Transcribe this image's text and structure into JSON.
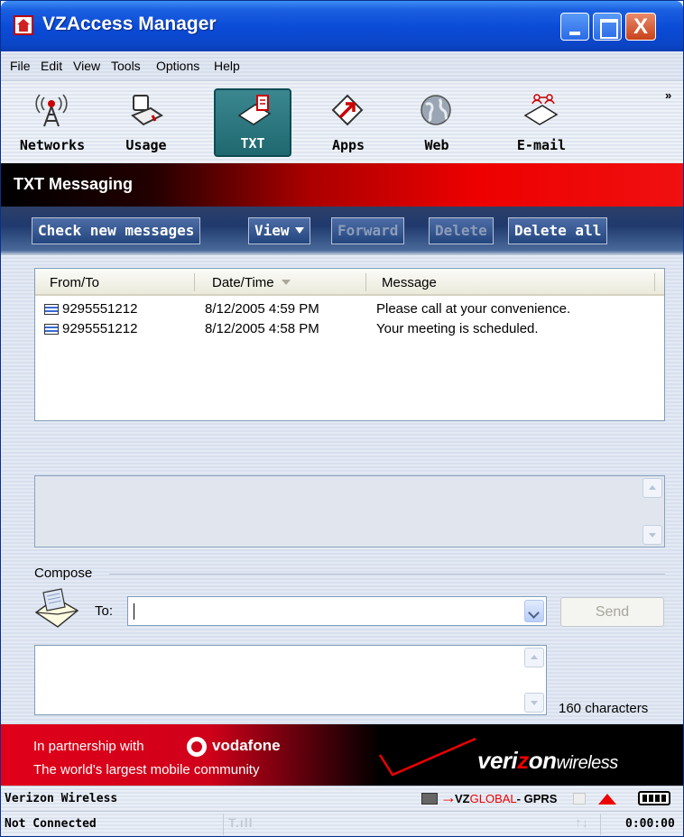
{
  "window": {
    "title": "VZAccess Manager",
    "close_glyph": "X"
  },
  "menu": [
    "File",
    "Edit",
    "View",
    "Tools",
    "Options",
    "Help"
  ],
  "toolbar": {
    "buttons": [
      {
        "label": "Networks",
        "icon": "antenna-tower-icon",
        "active": false
      },
      {
        "label": "Usage",
        "icon": "usage-laptop-icon",
        "active": false
      },
      {
        "label": "TXT",
        "icon": "txt-envelope-icon",
        "active": true
      },
      {
        "label": "Apps",
        "icon": "apps-arrow-icon",
        "active": false
      },
      {
        "label": "Web",
        "icon": "globe-icon",
        "active": false
      },
      {
        "label": "E-mail",
        "icon": "email-envelope-icon",
        "active": false
      }
    ],
    "more": "»"
  },
  "section": {
    "title": "TXT Messaging"
  },
  "actions": {
    "check_new": "Check new messages",
    "view": "View",
    "forward": "Forward",
    "delete": "Delete",
    "delete_all": "Delete all"
  },
  "messages": {
    "columns": {
      "from_to": "From/To",
      "date_time": "Date/Time",
      "message": "Message"
    },
    "rows": [
      {
        "from_to": "9295551212",
        "date_time": "8/12/2005 4:59 PM",
        "message": "Please call at your convenience."
      },
      {
        "from_to": "9295551212",
        "date_time": "8/12/2005 4:58 PM",
        "message": "Your meeting is scheduled."
      }
    ]
  },
  "compose": {
    "label": "Compose",
    "to_label": "To:",
    "to_value": "",
    "send": "Send",
    "body": "",
    "char_count": "160 characters"
  },
  "partner": {
    "line1": "In partnership with",
    "brand": "vodafone",
    "line2": "The world's largest mobile community",
    "vz_pre": "veri",
    "vz_z": "z",
    "vz_post": "on",
    "vz_wireless": "wireless"
  },
  "status": {
    "carrier": "Verizon Wireless",
    "network_prefix": "VZ",
    "network_global": "GLOBAL",
    "network_suffix": "- GPRS",
    "connection": "Not Connected",
    "timer": "0:00:00",
    "signal": "T.ıll",
    "arrows": "↑↓"
  },
  "colors": {
    "title_bar": "#0a4ad6",
    "banner_red": "#e00000",
    "active_toolbar": "#2a7880",
    "action_bar": "#203a6e"
  }
}
